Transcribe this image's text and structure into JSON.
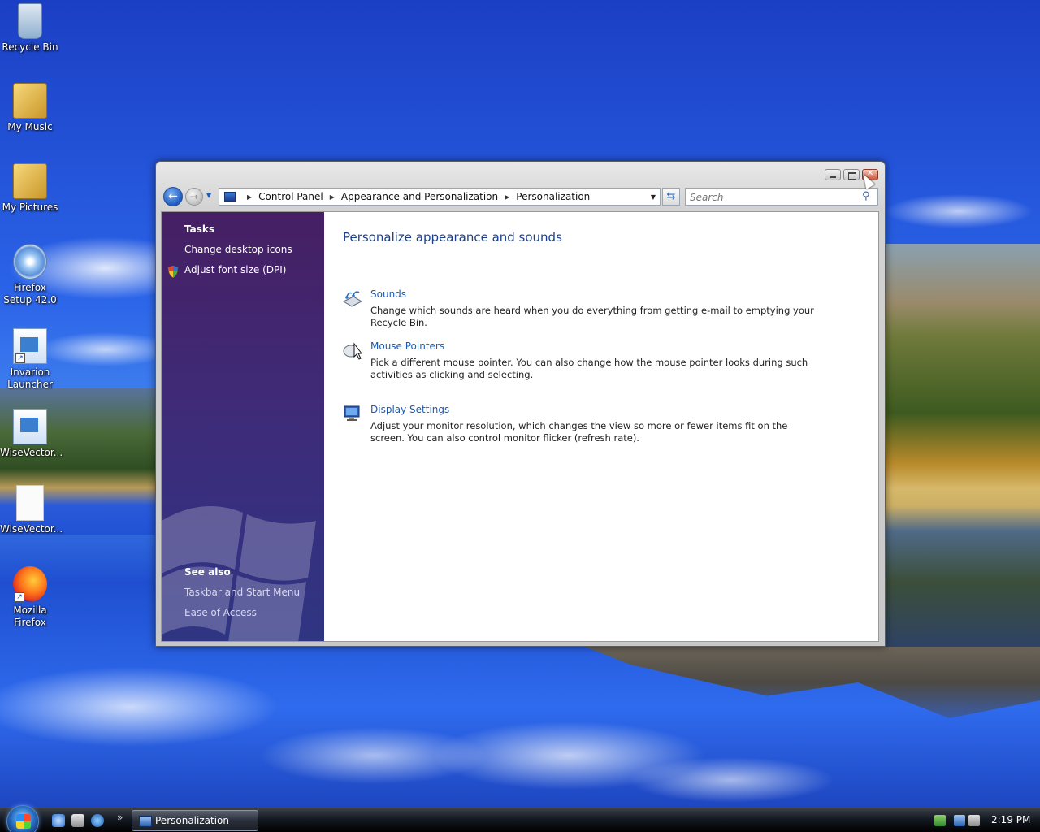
{
  "desktop": {
    "icons": [
      {
        "label": "Recycle Bin",
        "icon": "recycle-bin-icon"
      },
      {
        "label": "My Music",
        "icon": "music-folder-icon"
      },
      {
        "label": "My Pictures",
        "icon": "pictures-folder-icon"
      },
      {
        "label": "Firefox Setup 42.0",
        "icon": "setup-disc-icon"
      },
      {
        "label": "Invarion Launcher",
        "icon": "app-shortcut-icon"
      },
      {
        "label": "WiseVector...",
        "icon": "app-icon"
      },
      {
        "label": "WiseVector...",
        "icon": "document-icon"
      },
      {
        "label": "Mozilla Firefox",
        "icon": "firefox-icon"
      }
    ]
  },
  "window": {
    "address": {
      "crumbs": [
        "Control Panel",
        "Appearance and Personalization",
        "Personalization"
      ]
    },
    "search": {
      "placeholder": "Search"
    },
    "sidebar": {
      "tasks_heading": "Tasks",
      "tasks": [
        "Change desktop icons",
        "Adjust font size (DPI)"
      ],
      "see_also_heading": "See also",
      "see_also": [
        "Taskbar and Start Menu",
        "Ease of Access"
      ]
    },
    "main": {
      "title": "Personalize appearance and sounds",
      "items": [
        {
          "link": "Sounds",
          "desc": "Change which sounds are heard when you do everything from getting e-mail to emptying your Recycle Bin."
        },
        {
          "link": "Mouse Pointers",
          "desc": "Pick a different mouse pointer. You can also change how the mouse pointer looks during such activities as clicking and selecting."
        },
        {
          "link": "Display Settings",
          "desc": "Adjust your monitor resolution, which changes the view so more or fewer items fit on the screen. You can also control monitor flicker (refresh rate)."
        }
      ]
    }
  },
  "taskbar": {
    "active_task": "Personalization",
    "clock": "2:19 PM"
  },
  "colors": {
    "link": "#1a5ab8",
    "title": "#1c3f8c",
    "sidebar": "#3f2b78"
  }
}
